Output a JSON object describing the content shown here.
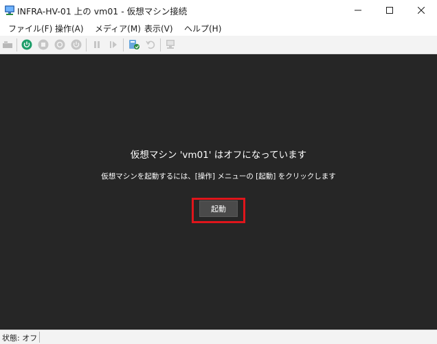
{
  "window": {
    "title": "INFRA-HV-01 上の vm01  - 仮想マシン接続",
    "icon": "vm-connection-icon"
  },
  "menu": {
    "items": [
      {
        "label": "ファイル(F)"
      },
      {
        "label": "操作(A)"
      },
      {
        "label": "メディア(M)"
      },
      {
        "label": "表示(V)"
      },
      {
        "label": "ヘルプ(H)"
      }
    ]
  },
  "toolbar": {
    "icons": [
      "ctrl-alt-del-icon",
      "start-icon",
      "turn-off-icon",
      "shutdown-icon",
      "save-icon",
      "pause-icon",
      "resume-icon",
      "checkpoint-icon",
      "revert-icon",
      "enhanced-session-icon"
    ]
  },
  "console": {
    "message": "仮想マシン 'vm01' はオフになっています",
    "instruction": "仮想マシンを起動するには、[操作] メニューの [起動] をクリックします",
    "start_button": "起動"
  },
  "status": {
    "text": "状態: オフ"
  },
  "colors": {
    "console_bg": "#262626",
    "highlight": "#e0151b",
    "start_icon": "#1e9e6a"
  }
}
